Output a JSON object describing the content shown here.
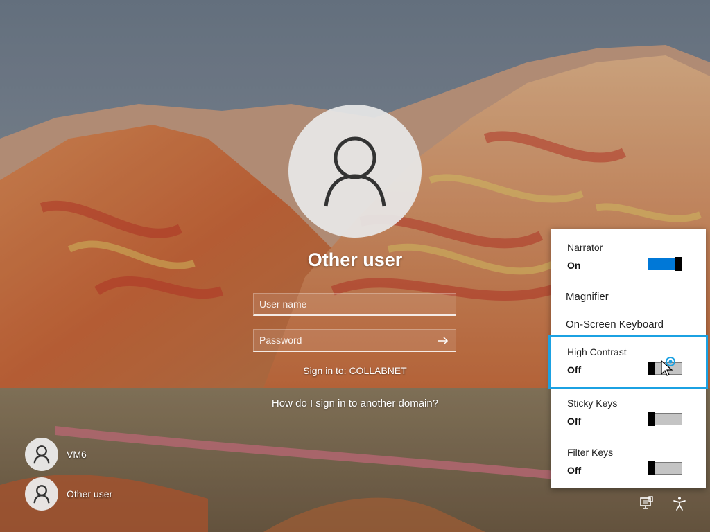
{
  "login": {
    "user_title": "Other user",
    "username_placeholder": "User name",
    "password_placeholder": "Password",
    "sign_in_to": "Sign in to: COLLABNET",
    "other_domain_link": "How do I sign in to another domain?"
  },
  "user_list": [
    {
      "name": "VM6",
      "icon": "person-icon"
    },
    {
      "name": "Other user",
      "icon": "person-icon"
    }
  ],
  "accessibility_menu": {
    "narrator": {
      "label": "Narrator",
      "state": "On",
      "enabled": true
    },
    "magnifier": {
      "label": "Magnifier"
    },
    "on_screen_keyboard": {
      "label": "On-Screen Keyboard"
    },
    "high_contrast": {
      "label": "High Contrast",
      "state": "Off",
      "enabled": false,
      "focused": true
    },
    "sticky_keys": {
      "label": "Sticky Keys",
      "state": "Off",
      "enabled": false
    },
    "filter_keys": {
      "label": "Filter Keys",
      "state": "Off",
      "enabled": false
    }
  },
  "system_icons": [
    "network-icon",
    "accessibility-icon"
  ],
  "colors": {
    "toggle_on": "#0078d7",
    "focus_outline": "#1ba1e2"
  }
}
